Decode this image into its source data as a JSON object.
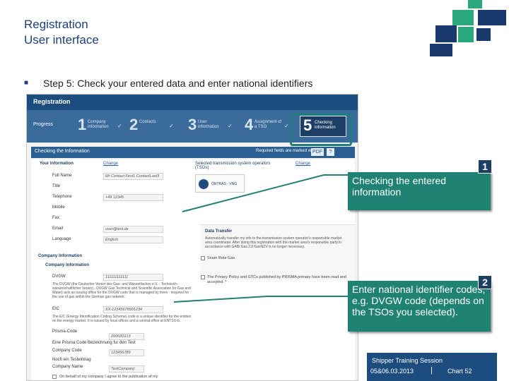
{
  "slide": {
    "title_line1": "Registration",
    "title_line2": "User interface",
    "bullet_text": "Step 5: Check your entered data and enter national identifiers"
  },
  "colors": {
    "navy": "#1d4d7e",
    "callout_green": "#208272",
    "logo_green": "#2ba87c"
  },
  "app": {
    "tab_title": "Registration",
    "progress_label": "Progress",
    "steps": [
      {
        "num": "1",
        "label": "Company information",
        "done": "✓"
      },
      {
        "num": "2",
        "label": "Contacts",
        "done": "✓"
      },
      {
        "num": "3",
        "label": "User information",
        "done": "✓"
      },
      {
        "num": "4",
        "label": "Assignment of a TSO",
        "done": "✓"
      },
      {
        "num": "5",
        "label": "Checking information",
        "done": ""
      }
    ],
    "info_header": "Checking the Information",
    "required_note": "Required fields are marked with a *",
    "pdf_label": "PDF",
    "help_label": "?",
    "your_info": "Your Information",
    "change_label": "Change",
    "tso_header": "Selected transmission system operators (TSOs)",
    "tso_name": "ONTRAS - VNG",
    "fields": [
      {
        "label": "Full Name",
        "value": "Mr Contact First1 ContactLast3"
      },
      {
        "label": "Title",
        "value": ""
      },
      {
        "label": "Telephone",
        "value": "+49 12345"
      },
      {
        "label": "Mobile",
        "value": ""
      },
      {
        "label": "Fax",
        "value": ""
      },
      {
        "label": "Email",
        "value": "user@test.de"
      },
      {
        "label": "Language",
        "value": "English"
      }
    ],
    "data_transfer": {
      "title": "Data Transfer",
      "text": "Automatically transfer my info to the transmission system operator's responsible market area coordinator. After doing this registration with the market area's responsible party in accordance with GABi Gas 2.0 GasNZV is no longer necessary.",
      "checkbox": "Snam Rete Gas"
    },
    "company_info_h1": "Company Information",
    "company_info_h2": "Company Information",
    "privacy_text": "The Privacy Policy and GTCs published by PRISMA primary have been read and accepted. *",
    "dvgw_label": "DVGW",
    "dvgw_value": "111111111111",
    "dvgw_desc": "The DVGW (the Deutscher Verein des Gas- und Wasserfaches e.V. - Technisch-wissenschaftlicher Verein) - DVGW Gas Technical and Scientific Association for Gas and Water) acts as issuing office for the DVGW code that is managed by them - required for the use of gas within the German gas network.",
    "eic_label": "EIC",
    "eic_value": "XX-12345678901234",
    "eic_desc": "The EIC (Energy Identification Coding Scheme) code is a unique identifier for the entities on the energy market. It is issued by local offices and a central office at ENTSO-E.",
    "prima_label": "Prisma-Code",
    "prima_value": "200020213",
    "prima_test_label": "Eine Prisma Code Bezeichnung fur den Test",
    "company_code_label": "Company Code",
    "company_code_value": "123456789",
    "test_label": "Noch ein Testeintrag",
    "company_name_label": "Company Name",
    "company_name_value": "TestCompany",
    "consent_text": "On behalf of my company I agree to the publication of my"
  },
  "callouts": [
    {
      "number": "1",
      "text": "Checking the entered information"
    },
    {
      "number": "2",
      "text": "Enter national identifier codes, e.g. DVGW code (depends on the TSOs you selected)."
    }
  ],
  "footer": {
    "session": "Shipper Training Session",
    "date": "05&06.03.2013",
    "separator": "|",
    "chart": "Chart 52"
  }
}
